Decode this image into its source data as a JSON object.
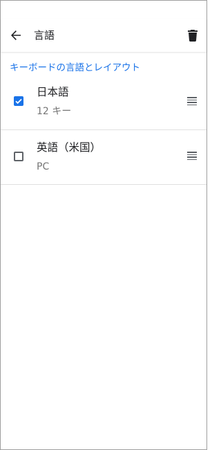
{
  "app_bar": {
    "title": "言語",
    "back_icon": "arrow-back-icon",
    "delete_icon": "trash-icon"
  },
  "section": {
    "header": "キーボードの言語とレイアウト"
  },
  "languages": [
    {
      "name": "日本語",
      "layout": "12 キー",
      "checked": true
    },
    {
      "name": "英語（米国）",
      "layout": "PC",
      "checked": false
    }
  ],
  "colors": {
    "accent": "#1a73e8",
    "primary_text": "#202124",
    "secondary_text": "#757575",
    "divider": "#e0e0e0"
  }
}
